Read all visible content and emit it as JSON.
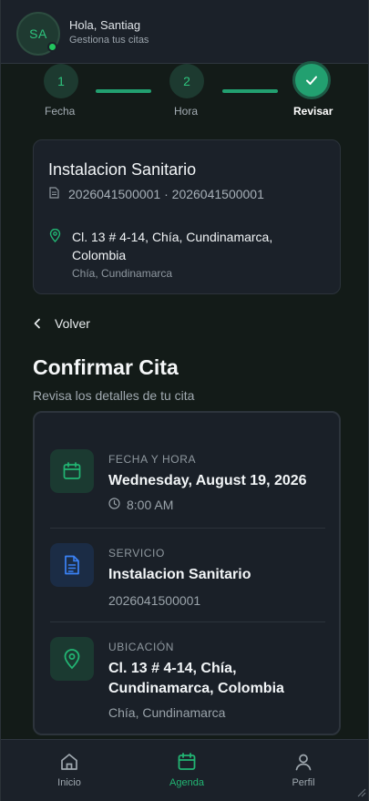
{
  "header": {
    "avatar_initials": "SA",
    "greeting": "Hola, Santiag",
    "subtitle": "Gestiona tus citas"
  },
  "stepper": {
    "steps": [
      {
        "number": "1",
        "label": "Fecha",
        "state": "pending"
      },
      {
        "number": "2",
        "label": "Hora",
        "state": "pending"
      },
      {
        "number": "",
        "label": "Revisar",
        "state": "done"
      }
    ]
  },
  "job_card": {
    "title": "Instalacion Sanitario",
    "ids": "2026041500001 · 2026041500001",
    "address": "Cl. 13 # 4-14, Chía, Cundinamarca, Colombia",
    "city": "Chía, Cundinamarca"
  },
  "back_label": "Volver",
  "page": {
    "title": "Confirmar Cita",
    "subtitle": "Revisa los detalles de tu cita"
  },
  "confirm": {
    "datetime": {
      "label": "FECHA Y HORA",
      "date": "Wednesday, August 19, 2026",
      "time": "8:00 AM"
    },
    "service": {
      "label": "SERVICIO",
      "name": "Instalacion Sanitario",
      "code": "2026041500001"
    },
    "location": {
      "label": "UBICACIÓN",
      "address": "Cl. 13 # 4-14, Chía, Cundinamarca, Colombia",
      "city": "Chía, Cundinamarca"
    }
  },
  "bottom_nav": {
    "items": [
      {
        "label": "Inicio",
        "icon": "home-icon",
        "active": false
      },
      {
        "label": "Agenda",
        "icon": "calendar-icon",
        "active": true
      },
      {
        "label": "Perfil",
        "icon": "user-icon",
        "active": false
      }
    ]
  },
  "colors": {
    "accent": "#22b573",
    "background": "#131b18",
    "card": "#1b2129"
  }
}
